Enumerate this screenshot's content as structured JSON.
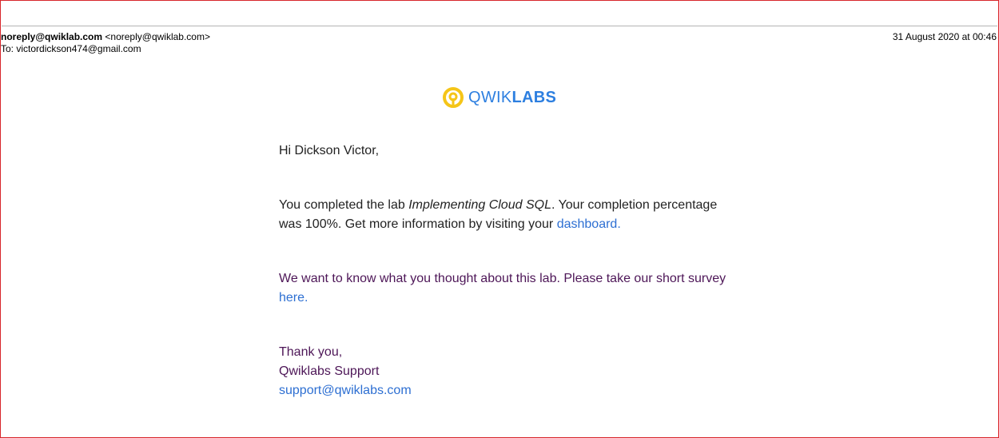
{
  "header": {
    "from_name": "noreply@qwiklab.com",
    "from_address": "<noreply@qwiklab.com>",
    "to_label": "To:",
    "to_address": "victordickson474@gmail.com",
    "date": "31 August 2020 at 00:46"
  },
  "logo": {
    "icon": "qwiklabs-logo-icon",
    "text_light": "QWIK",
    "text_bold": "LABS"
  },
  "body": {
    "greeting": "Hi Dickson Victor,",
    "completion_1": "You completed the lab ",
    "lab_name": "Implementing Cloud SQL",
    "completion_2": ". Your completion percentage was 100%. Get more information by visiting your ",
    "dashboard_link": "dashboard.",
    "survey_text": "We want to know what you thought about this lab. Please take our short survey ",
    "survey_link": "here.",
    "thanks": "Thank you,",
    "signature": "Qwiklabs Support",
    "support_email": "support@qwiklabs.com"
  },
  "colors": {
    "border": "#d7262b",
    "link": "#2d6fd2",
    "purple_text": "#4d1657",
    "logo_blue": "#2d7fe0",
    "logo_yellow": "#f5c518"
  }
}
